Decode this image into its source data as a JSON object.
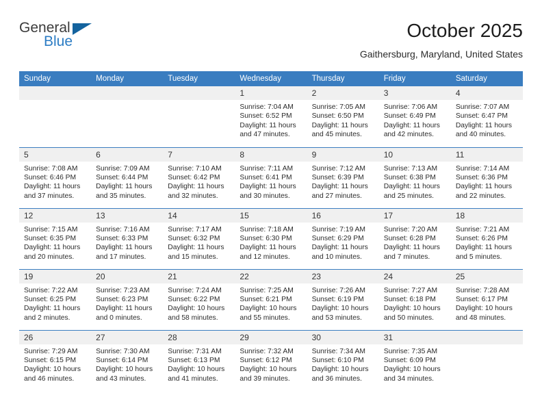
{
  "logo": {
    "primary_text": "General",
    "secondary_text": "Blue",
    "triangle_icon": "triangle-icon",
    "primary_color": "#3b3b3b",
    "secondary_color": "#2b7cc4",
    "triangle_color": "#14639e"
  },
  "header": {
    "title": "October 2025",
    "subtitle": "Gaithersburg, Maryland, United States"
  },
  "theme": {
    "header_bg": "#3a7dc0",
    "daynum_bg": "#f0f0f0",
    "text": "#2b2b2b"
  },
  "calendar": {
    "weekday_headers": [
      "Sunday",
      "Monday",
      "Tuesday",
      "Wednesday",
      "Thursday",
      "Friday",
      "Saturday"
    ],
    "weeks": [
      [
        {
          "day": "",
          "empty": true,
          "sunrise": "",
          "sunset": "",
          "daylight_line1": "",
          "daylight_line2": ""
        },
        {
          "day": "",
          "empty": true,
          "sunrise": "",
          "sunset": "",
          "daylight_line1": "",
          "daylight_line2": ""
        },
        {
          "day": "",
          "empty": true,
          "sunrise": "",
          "sunset": "",
          "daylight_line1": "",
          "daylight_line2": ""
        },
        {
          "day": "1",
          "empty": false,
          "sunrise": "Sunrise: 7:04 AM",
          "sunset": "Sunset: 6:52 PM",
          "daylight_line1": "Daylight: 11 hours",
          "daylight_line2": "and 47 minutes."
        },
        {
          "day": "2",
          "empty": false,
          "sunrise": "Sunrise: 7:05 AM",
          "sunset": "Sunset: 6:50 PM",
          "daylight_line1": "Daylight: 11 hours",
          "daylight_line2": "and 45 minutes."
        },
        {
          "day": "3",
          "empty": false,
          "sunrise": "Sunrise: 7:06 AM",
          "sunset": "Sunset: 6:49 PM",
          "daylight_line1": "Daylight: 11 hours",
          "daylight_line2": "and 42 minutes."
        },
        {
          "day": "4",
          "empty": false,
          "sunrise": "Sunrise: 7:07 AM",
          "sunset": "Sunset: 6:47 PM",
          "daylight_line1": "Daylight: 11 hours",
          "daylight_line2": "and 40 minutes."
        }
      ],
      [
        {
          "day": "5",
          "empty": false,
          "sunrise": "Sunrise: 7:08 AM",
          "sunset": "Sunset: 6:46 PM",
          "daylight_line1": "Daylight: 11 hours",
          "daylight_line2": "and 37 minutes."
        },
        {
          "day": "6",
          "empty": false,
          "sunrise": "Sunrise: 7:09 AM",
          "sunset": "Sunset: 6:44 PM",
          "daylight_line1": "Daylight: 11 hours",
          "daylight_line2": "and 35 minutes."
        },
        {
          "day": "7",
          "empty": false,
          "sunrise": "Sunrise: 7:10 AM",
          "sunset": "Sunset: 6:42 PM",
          "daylight_line1": "Daylight: 11 hours",
          "daylight_line2": "and 32 minutes."
        },
        {
          "day": "8",
          "empty": false,
          "sunrise": "Sunrise: 7:11 AM",
          "sunset": "Sunset: 6:41 PM",
          "daylight_line1": "Daylight: 11 hours",
          "daylight_line2": "and 30 minutes."
        },
        {
          "day": "9",
          "empty": false,
          "sunrise": "Sunrise: 7:12 AM",
          "sunset": "Sunset: 6:39 PM",
          "daylight_line1": "Daylight: 11 hours",
          "daylight_line2": "and 27 minutes."
        },
        {
          "day": "10",
          "empty": false,
          "sunrise": "Sunrise: 7:13 AM",
          "sunset": "Sunset: 6:38 PM",
          "daylight_line1": "Daylight: 11 hours",
          "daylight_line2": "and 25 minutes."
        },
        {
          "day": "11",
          "empty": false,
          "sunrise": "Sunrise: 7:14 AM",
          "sunset": "Sunset: 6:36 PM",
          "daylight_line1": "Daylight: 11 hours",
          "daylight_line2": "and 22 minutes."
        }
      ],
      [
        {
          "day": "12",
          "empty": false,
          "sunrise": "Sunrise: 7:15 AM",
          "sunset": "Sunset: 6:35 PM",
          "daylight_line1": "Daylight: 11 hours",
          "daylight_line2": "and 20 minutes."
        },
        {
          "day": "13",
          "empty": false,
          "sunrise": "Sunrise: 7:16 AM",
          "sunset": "Sunset: 6:33 PM",
          "daylight_line1": "Daylight: 11 hours",
          "daylight_line2": "and 17 minutes."
        },
        {
          "day": "14",
          "empty": false,
          "sunrise": "Sunrise: 7:17 AM",
          "sunset": "Sunset: 6:32 PM",
          "daylight_line1": "Daylight: 11 hours",
          "daylight_line2": "and 15 minutes."
        },
        {
          "day": "15",
          "empty": false,
          "sunrise": "Sunrise: 7:18 AM",
          "sunset": "Sunset: 6:30 PM",
          "daylight_line1": "Daylight: 11 hours",
          "daylight_line2": "and 12 minutes."
        },
        {
          "day": "16",
          "empty": false,
          "sunrise": "Sunrise: 7:19 AM",
          "sunset": "Sunset: 6:29 PM",
          "daylight_line1": "Daylight: 11 hours",
          "daylight_line2": "and 10 minutes."
        },
        {
          "day": "17",
          "empty": false,
          "sunrise": "Sunrise: 7:20 AM",
          "sunset": "Sunset: 6:28 PM",
          "daylight_line1": "Daylight: 11 hours",
          "daylight_line2": "and 7 minutes."
        },
        {
          "day": "18",
          "empty": false,
          "sunrise": "Sunrise: 7:21 AM",
          "sunset": "Sunset: 6:26 PM",
          "daylight_line1": "Daylight: 11 hours",
          "daylight_line2": "and 5 minutes."
        }
      ],
      [
        {
          "day": "19",
          "empty": false,
          "sunrise": "Sunrise: 7:22 AM",
          "sunset": "Sunset: 6:25 PM",
          "daylight_line1": "Daylight: 11 hours",
          "daylight_line2": "and 2 minutes."
        },
        {
          "day": "20",
          "empty": false,
          "sunrise": "Sunrise: 7:23 AM",
          "sunset": "Sunset: 6:23 PM",
          "daylight_line1": "Daylight: 11 hours",
          "daylight_line2": "and 0 minutes."
        },
        {
          "day": "21",
          "empty": false,
          "sunrise": "Sunrise: 7:24 AM",
          "sunset": "Sunset: 6:22 PM",
          "daylight_line1": "Daylight: 10 hours",
          "daylight_line2": "and 58 minutes."
        },
        {
          "day": "22",
          "empty": false,
          "sunrise": "Sunrise: 7:25 AM",
          "sunset": "Sunset: 6:21 PM",
          "daylight_line1": "Daylight: 10 hours",
          "daylight_line2": "and 55 minutes."
        },
        {
          "day": "23",
          "empty": false,
          "sunrise": "Sunrise: 7:26 AM",
          "sunset": "Sunset: 6:19 PM",
          "daylight_line1": "Daylight: 10 hours",
          "daylight_line2": "and 53 minutes."
        },
        {
          "day": "24",
          "empty": false,
          "sunrise": "Sunrise: 7:27 AM",
          "sunset": "Sunset: 6:18 PM",
          "daylight_line1": "Daylight: 10 hours",
          "daylight_line2": "and 50 minutes."
        },
        {
          "day": "25",
          "empty": false,
          "sunrise": "Sunrise: 7:28 AM",
          "sunset": "Sunset: 6:17 PM",
          "daylight_line1": "Daylight: 10 hours",
          "daylight_line2": "and 48 minutes."
        }
      ],
      [
        {
          "day": "26",
          "empty": false,
          "sunrise": "Sunrise: 7:29 AM",
          "sunset": "Sunset: 6:15 PM",
          "daylight_line1": "Daylight: 10 hours",
          "daylight_line2": "and 46 minutes."
        },
        {
          "day": "27",
          "empty": false,
          "sunrise": "Sunrise: 7:30 AM",
          "sunset": "Sunset: 6:14 PM",
          "daylight_line1": "Daylight: 10 hours",
          "daylight_line2": "and 43 minutes."
        },
        {
          "day": "28",
          "empty": false,
          "sunrise": "Sunrise: 7:31 AM",
          "sunset": "Sunset: 6:13 PM",
          "daylight_line1": "Daylight: 10 hours",
          "daylight_line2": "and 41 minutes."
        },
        {
          "day": "29",
          "empty": false,
          "sunrise": "Sunrise: 7:32 AM",
          "sunset": "Sunset: 6:12 PM",
          "daylight_line1": "Daylight: 10 hours",
          "daylight_line2": "and 39 minutes."
        },
        {
          "day": "30",
          "empty": false,
          "sunrise": "Sunrise: 7:34 AM",
          "sunset": "Sunset: 6:10 PM",
          "daylight_line1": "Daylight: 10 hours",
          "daylight_line2": "and 36 minutes."
        },
        {
          "day": "31",
          "empty": false,
          "sunrise": "Sunrise: 7:35 AM",
          "sunset": "Sunset: 6:09 PM",
          "daylight_line1": "Daylight: 10 hours",
          "daylight_line2": "and 34 minutes."
        },
        {
          "day": "",
          "empty": true,
          "sunrise": "",
          "sunset": "",
          "daylight_line1": "",
          "daylight_line2": ""
        }
      ]
    ]
  }
}
